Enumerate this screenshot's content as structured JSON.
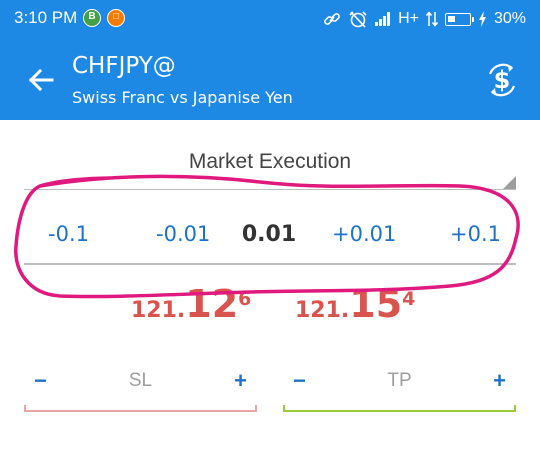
{
  "status_bar": {
    "time": "3:10 PM",
    "app_icon_1": "B",
    "app_icon_2": "□",
    "network": "H+",
    "battery_percent": "30%"
  },
  "toolbar": {
    "symbol": "CHFJPY@",
    "description": "Swiss Franc vs Japanise Yen"
  },
  "execution": {
    "mode": "Market Execution"
  },
  "volume": {
    "minus_large": "-0.1",
    "minus_small": "-0.01",
    "value": "0.01",
    "plus_small": "+0.01",
    "plus_large": "+0.1"
  },
  "prices": {
    "bid": {
      "prefix": "121.",
      "big": "12",
      "pip": "6"
    },
    "ask": {
      "prefix": "121.",
      "big": "15",
      "pip": "4"
    }
  },
  "stops": {
    "sl": {
      "minus": "−",
      "label": "SL",
      "plus": "+"
    },
    "tp": {
      "minus": "−",
      "label": "TP",
      "plus": "+"
    }
  },
  "colors": {
    "primary": "#1e88e5",
    "price": "#d9534f",
    "stepper": "#1e73c8",
    "sl_line": "#e8a5a5",
    "tp_line": "#9ccc3a",
    "annotation": "#e0197f"
  },
  "icons": [
    "arrow-back-icon",
    "currency-exchange-icon",
    "link-icon",
    "alarm-off-icon",
    "signal-icon",
    "data-transfer-icon",
    "battery-icon"
  ]
}
